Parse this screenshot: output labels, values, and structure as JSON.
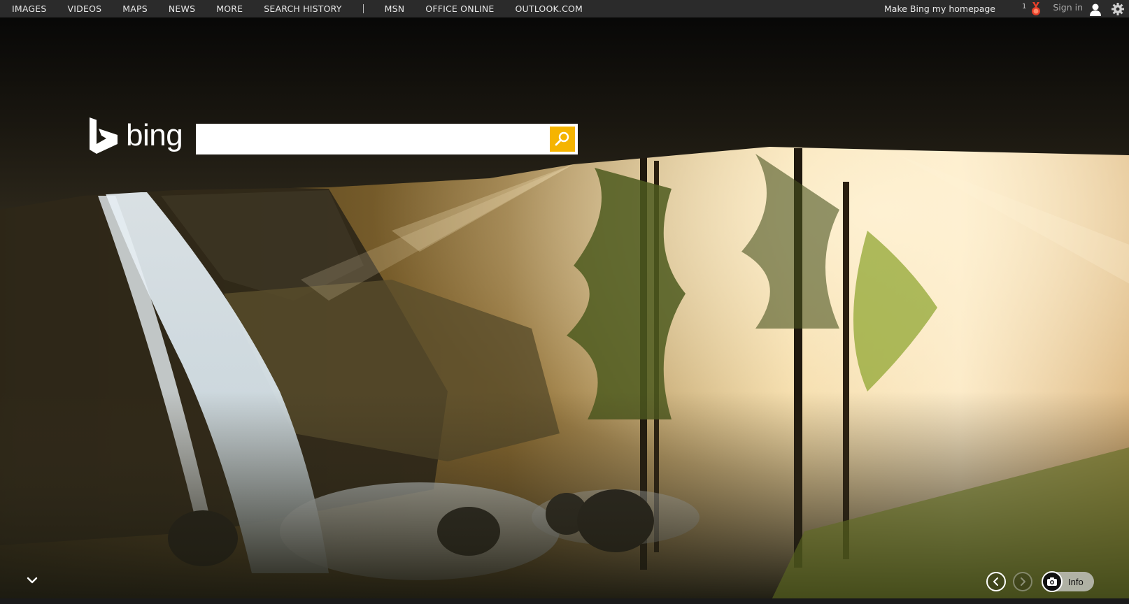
{
  "nav": {
    "items": [
      "IMAGES",
      "VIDEOS",
      "MAPS",
      "NEWS",
      "MORE",
      "SEARCH HISTORY"
    ],
    "links": [
      "MSN",
      "OFFICE ONLINE",
      "OUTLOOK.COM"
    ]
  },
  "header": {
    "homepage": "Make Bing my homepage",
    "rewards_count": "1",
    "signin": "Sign in"
  },
  "logo": {
    "text": "bing"
  },
  "search": {
    "value": "",
    "placeholder": ""
  },
  "controls": {
    "info_label": "Info"
  },
  "icons": {
    "medal": "medal-icon",
    "user": "user-icon",
    "settings": "gear-icon",
    "search": "search-icon",
    "prev": "chevron-left-icon",
    "next": "chevron-right-icon",
    "camera": "camera-icon",
    "scroll": "chevron-down-icon"
  },
  "colors": {
    "topbar": "#2b2b2b",
    "search_button": "#f5b400",
    "medal": "#e8402a"
  }
}
